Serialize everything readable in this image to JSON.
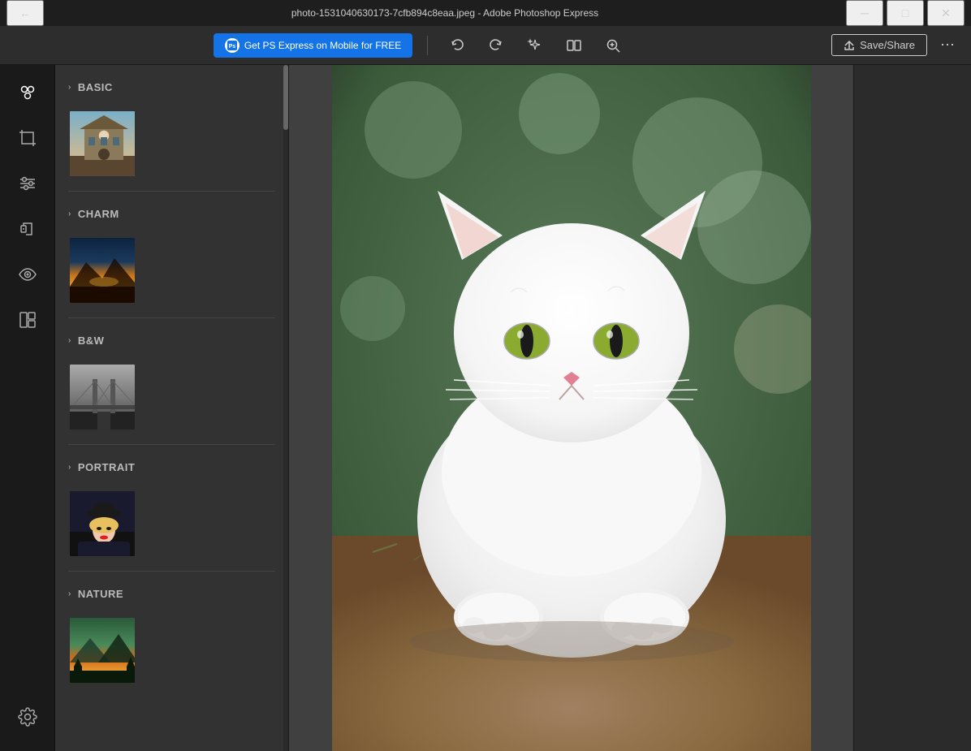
{
  "titleBar": {
    "title": "photo-1531040630173-7cfb894c8eaa.jpeg - Adobe Photoshop Express",
    "backIcon": "←",
    "minimizeIcon": "─",
    "maximizeIcon": "□",
    "closeIcon": "✕"
  },
  "toolbar": {
    "promoText": "Get PS Express on Mobile for FREE",
    "promoIconColor": "#1473e6",
    "undoIcon": "↺",
    "redoIcon": "↻",
    "magicIcon": "✦",
    "compareIcon": "▫",
    "zoomIcon": "+",
    "saveShareLabel": "Save/Share",
    "moreIcon": "⋯"
  },
  "iconSidebar": {
    "items": [
      {
        "icon": "◎",
        "name": "filters-icon",
        "label": "Filters",
        "active": true
      },
      {
        "icon": "⬜",
        "name": "crop-icon",
        "label": "Crop"
      },
      {
        "icon": "≡",
        "name": "adjustments-icon",
        "label": "Adjustments"
      },
      {
        "icon": "⬜",
        "name": "healing-icon",
        "label": "Healing"
      },
      {
        "icon": "◉",
        "name": "redeye-icon",
        "label": "Red Eye"
      },
      {
        "icon": "◫",
        "name": "collage-icon",
        "label": "Collage"
      }
    ],
    "bottomItems": [
      {
        "icon": "⚙",
        "name": "settings-icon",
        "label": "Settings"
      }
    ]
  },
  "filterSections": [
    {
      "id": "basic",
      "label": "BASIC",
      "expanded": true
    },
    {
      "id": "charm",
      "label": "CHARM",
      "expanded": true
    },
    {
      "id": "bw",
      "label": "B&W",
      "expanded": true
    },
    {
      "id": "portrait",
      "label": "PORTRAIT",
      "expanded": true
    },
    {
      "id": "nature",
      "label": "NATURE",
      "expanded": true
    }
  ],
  "colors": {
    "accent": "#1473e6",
    "background": "#323232",
    "titlebar": "#1e1e1e",
    "sidebar": "#1a1a1a"
  }
}
